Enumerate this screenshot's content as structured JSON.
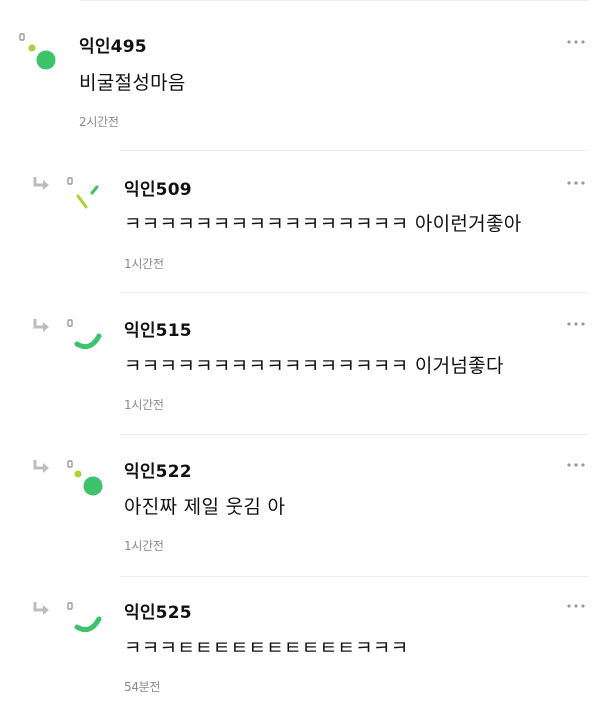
{
  "comments": [
    {
      "author": "익인495",
      "text": "비굴절성마음",
      "time": "2시간전"
    },
    {
      "author": "익인509",
      "text": "ㅋㅋㅋㅋㅋㅋㅋㅋㅋㅋㅋㅋㅋㅋㅋㅋ 아이런거좋아",
      "time": "1시간전"
    },
    {
      "author": "익인515",
      "text": "ㅋㅋㅋㅋㅋㅋㅋㅋㅋㅋㅋㅋㅋㅋㅋㅋ 이거넘좋다",
      "time": "1시간전"
    },
    {
      "author": "익인522",
      "text": "아진짜 제일 웃김 아",
      "time": "1시간전"
    },
    {
      "author": "익인525",
      "text": "ㅋㅋㅋㅌㅌㅌㅌㅌㅌㅌㅌㅌㅌㅋㅋㅋ",
      "time": "54분전"
    }
  ],
  "icons": {
    "reply": "reply-arrow-icon",
    "more": "more-options-icon"
  },
  "colors": {
    "green": "#3cc36b",
    "lime": "#a8d534",
    "gray_dot": "#9a9a9a",
    "reply_arrow": "#bdbdbd"
  }
}
